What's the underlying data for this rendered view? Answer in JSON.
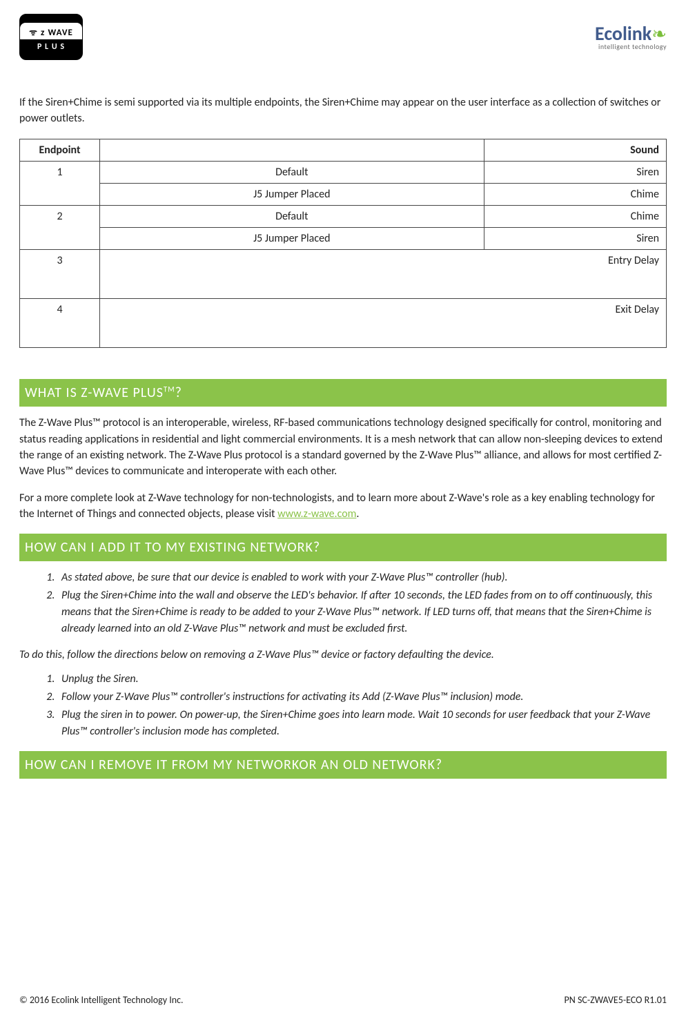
{
  "header": {
    "zwave_top": "ᯤ ᴢ WAVE",
    "zwave_bottom": "P L U S",
    "ecolink_brand": "Ecolink",
    "ecolink_tag": "intelligent technology"
  },
  "intro": "If the Siren+Chime is semi supported via its multiple endpoints, the Siren+Chime may appear on the user interface as a collection of switches or power outlets.",
  "table": {
    "headers": {
      "endpoint": "Endpoint",
      "sound": "Sound"
    },
    "rows": [
      {
        "endpoint": "1",
        "conditions": [
          "Default",
          "J5 Jumper Placed"
        ],
        "sounds": [
          "Siren",
          "Chime"
        ]
      },
      {
        "endpoint": "2",
        "conditions": [
          "Default",
          "J5 Jumper Placed"
        ],
        "sounds": [
          "Chime",
          "Siren"
        ]
      },
      {
        "endpoint": "3",
        "condition": "",
        "sound": "Entry Delay"
      },
      {
        "endpoint": "4",
        "condition": "",
        "sound": "Exit Delay"
      }
    ]
  },
  "sections": {
    "what_is": {
      "title_pre": "WHAT IS Z-WAVE PLUS",
      "title_tm": "TM",
      "title_post": "?",
      "para1": "The Z-Wave Plus™ protocol is an interoperable, wireless, RF-based communications technology designed specifically for control, monitoring and status reading applications in residential and light commercial environments. It is a mesh network that can allow non-sleeping devices to extend the range of an existing network. The Z-Wave Plus protocol is a standard governed by the Z-Wave Plus™ alliance, and allows for most certified Z-Wave Plus™ devices to communicate and interoperate with each other.",
      "para2_pre": "For a more complete look at Z-Wave technology for non-technologists, and to learn more about Z-Wave's role as a key enabling technology for the Internet of Things and connected objects, please visit ",
      "para2_link": "www.z-wave.com",
      "para2_post": "."
    },
    "add": {
      "title": "HOW CAN I ADD IT TO MY EXISTING NETWORK?",
      "steps_a": [
        "As stated above, be sure that our device is enabled to work with your Z-Wave Plus™ controller (hub).",
        "Plug the Siren+Chime into the wall and observe the LED's behavior. If after 10 seconds, the LED fades from on to off continuously, this means that the Siren+Chime is ready to be added to your  Z-Wave Plus™ network. If LED turns off, that means that the Siren+Chime is already learned into an old  Z-Wave Plus™ network and must be excluded first."
      ],
      "transition": "To do this, follow the directions below on removing a Z-Wave Plus™ device or factory defaulting the device.",
      "steps_b": [
        " Unplug the Siren.",
        "Follow your Z-Wave Plus™ controller's instructions for activating its Add (Z-Wave Plus™ inclusion) mode.",
        "Plug the siren in to power. On power-up, the Siren+Chime goes into learn mode. Wait 10 seconds for user feedback that your Z-Wave Plus™ controller's inclusion mode has completed."
      ]
    },
    "remove": {
      "title": "HOW CAN I REMOVE IT FROM MY NETWORKOR AN OLD NETWORK?"
    }
  },
  "footer": {
    "left": "© 2016 Ecolink Intelligent Technology Inc.",
    "right": "PN SC-ZWAVE5-ECO R1.01"
  }
}
